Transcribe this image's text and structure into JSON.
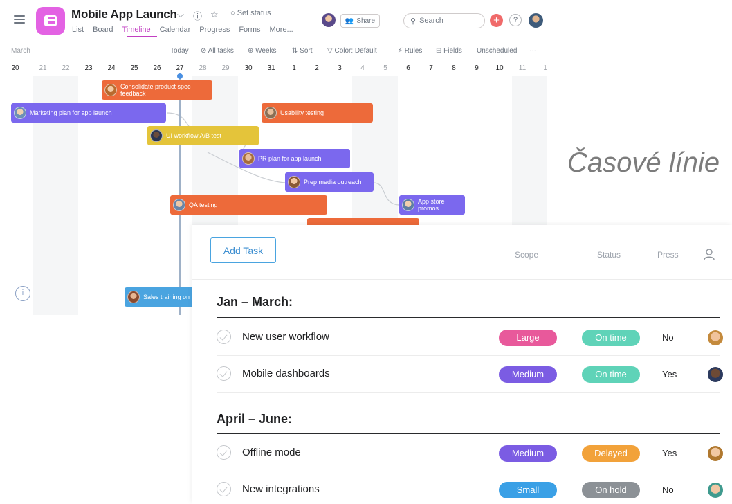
{
  "timeline": {
    "project_title": "Mobile App Launch",
    "set_status": "○ Set status",
    "tabs": [
      "List",
      "Board",
      "Timeline",
      "Calendar",
      "Progress",
      "Forms",
      "More..."
    ],
    "active_tab": "Timeline",
    "share_label": "Share",
    "search_placeholder": "Search",
    "toolbar": {
      "month": "March",
      "today": "Today",
      "all_tasks": "⊘ All tasks",
      "weeks": "⊕ Weeks",
      "sort": "⇅ Sort",
      "color": "▽ Color: Default",
      "rules": "⚡ Rules",
      "fields": "⊟ Fields",
      "unscheduled": "Unscheduled",
      "more": "···"
    },
    "days": [
      "20",
      "21",
      "22",
      "23",
      "24",
      "25",
      "26",
      "27",
      "28",
      "29",
      "30",
      "31",
      "1",
      "2",
      "3",
      "4",
      "5",
      "6",
      "7",
      "8",
      "9",
      "10",
      "11",
      "1"
    ],
    "bars": [
      {
        "label": "Consolidate product spec feedback",
        "color": "orange"
      },
      {
        "label": "Marketing plan for app launch",
        "color": "purple"
      },
      {
        "label": "Usability testing",
        "color": "orange"
      },
      {
        "label": "UI workflow A/B test",
        "color": "yellow"
      },
      {
        "label": "PR plan for app launch",
        "color": "purple"
      },
      {
        "label": "Prep media outreach",
        "color": "purple"
      },
      {
        "label": "QA testing",
        "color": "orange"
      },
      {
        "label": "App store promos",
        "color": "purple"
      },
      {
        "label": "Sales training on",
        "color": "blue"
      }
    ]
  },
  "caption": "Časové línie",
  "tasks": {
    "add_task": "Add Task",
    "columns": {
      "scope": "Scope",
      "status": "Status",
      "press": "Press"
    },
    "sections": [
      {
        "title": "Jan – March:",
        "rows": [
          {
            "name": "New user workflow",
            "scope": "Large",
            "scope_color": "#e8599b",
            "status": "On time",
            "status_color": "#5fd3b8",
            "press": "No"
          },
          {
            "name": "Mobile dashboards",
            "scope": "Medium",
            "scope_color": "#7b5ce3",
            "status": "On time",
            "status_color": "#5fd3b8",
            "press": "Yes"
          }
        ]
      },
      {
        "title": "April – June:",
        "rows": [
          {
            "name": "Offline mode",
            "scope": "Medium",
            "scope_color": "#7b5ce3",
            "status": "Delayed",
            "status_color": "#f2a23a",
            "press": "Yes"
          },
          {
            "name": "New integrations",
            "scope": "Small",
            "scope_color": "#3aa0e6",
            "status": "On hold",
            "status_color": "#8c9196",
            "press": "No"
          }
        ]
      }
    ]
  }
}
